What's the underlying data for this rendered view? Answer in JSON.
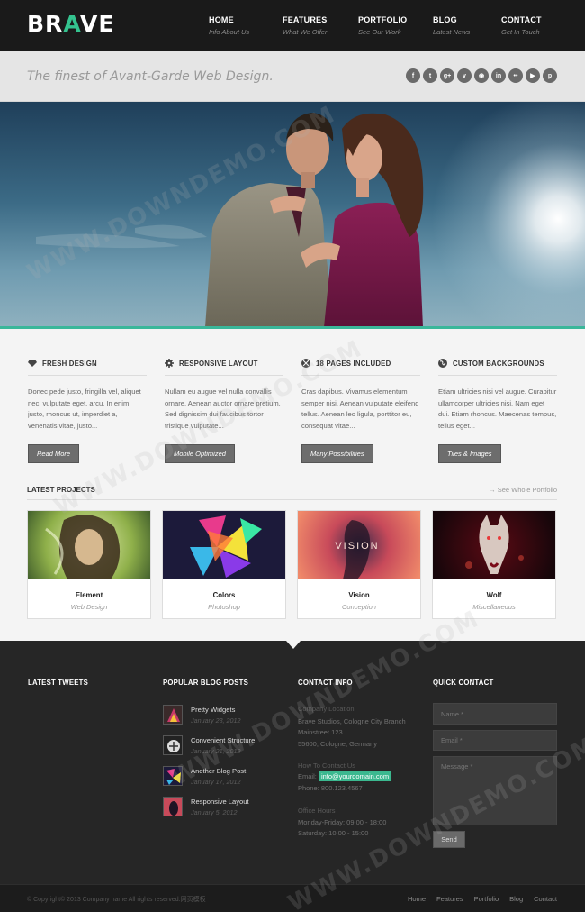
{
  "header": {
    "logo_part1": "BR",
    "logo_accent": "A",
    "logo_part2": "VE",
    "nav": [
      {
        "label": "HOME",
        "sub": "Info About Us"
      },
      {
        "label": "FEATURES",
        "sub": "What We Offer"
      },
      {
        "label": "PORTFOLIO",
        "sub": "See Our Work"
      },
      {
        "label": "BLOG",
        "sub": "Latest News"
      },
      {
        "label": "CONTACT",
        "sub": "Get In Touch"
      }
    ]
  },
  "tagline": "The finest of Avant-Garde Web Design.",
  "social_icons": [
    "facebook-icon",
    "twitter-icon",
    "google-plus-icon",
    "vimeo-icon",
    "rss-icon",
    "linkedin-icon",
    "flickr-icon",
    "youtube-icon",
    "pinterest-icon"
  ],
  "social_glyphs": [
    "f",
    "t",
    "g+",
    "v",
    "◉",
    "in",
    "••",
    "▶",
    "p"
  ],
  "features": [
    {
      "icon": "diamond-icon",
      "title": "FRESH DESIGN",
      "text": "Donec pede justo, fringilla vel, aliquet nec, vulputate eget, arcu. In enim justo, rhoncus ut, imperdiet a, venenatis vitae, justo...",
      "button": "Read More"
    },
    {
      "icon": "gear-icon",
      "title": "RESPONSIVE LAYOUT",
      "text": "Nullam eu augue vel nulla convallis ornare. Aenean auctor ornare pretium. Sed dignissim dui faucibus tortor tristique vulputate...",
      "button": "Mobile Optimized"
    },
    {
      "icon": "grid-circle-icon",
      "title": "18 PAGES INCLUDED",
      "text": "Cras dapibus. Vivamus elementum semper nisi. Aenean vulputate eleifend tellus. Aenean leo ligula, porttitor eu, consequat vitae...",
      "button": "Many Possibilities"
    },
    {
      "icon": "globe-icon",
      "title": "CUSTOM BACKGROUNDS",
      "text": "Etiam ultricies nisi vel augue. Curabitur ullamcorper ultricies nisi. Nam eget dui. Etiam rhoncus. Maecenas tempus, tellus eget...",
      "button": "Tiles & Images"
    }
  ],
  "projects": {
    "title": "LATEST PROJECTS",
    "link": "→ See Whole Portfolio",
    "items": [
      {
        "title": "Element",
        "category": "Web Design"
      },
      {
        "title": "Colors",
        "category": "Photoshop"
      },
      {
        "title": "Vision",
        "category": "Conception",
        "thumb_text": "VISION"
      },
      {
        "title": "Wolf",
        "category": "Miscellaneous"
      }
    ]
  },
  "footer": {
    "tweets_title": "LATEST TWEETS",
    "blog_title": "POPULAR BLOG POSTS",
    "posts": [
      {
        "title": "Pretty Widgets",
        "date": "January 23, 2012"
      },
      {
        "title": "Convenient Structure",
        "date": "January 21, 2012"
      },
      {
        "title": "Another Blog Post",
        "date": "January 17, 2012"
      },
      {
        "title": "Responsive Layout",
        "date": "January 5, 2012"
      }
    ],
    "contact_title": "CONTACT INFO",
    "location_label": "Company Location",
    "address": [
      "Brave Studios, Cologne City Branch",
      "Mainstreet 123",
      "55600, Cologne, Germany"
    ],
    "how_label": "How To Contact Us",
    "email_label": "Email:",
    "email": "info@yourdomain.com",
    "phone": "Phone: 800.123.4567",
    "hours_label": "Office Hours",
    "hours": [
      "Monday-Friday: 09:00 - 18:00",
      "Saturday: 10:00 - 15:00"
    ],
    "quick_title": "QUICK CONTACT",
    "name_placeholder": "Name *",
    "email_placeholder": "Email *",
    "message_placeholder": "Message *",
    "send": "Send"
  },
  "bottom": {
    "copyright": "© Copyright© 2013 Company name All rights reserved.网页模板",
    "links": [
      "Home",
      "Features",
      "Portfolio",
      "Blog",
      "Contact"
    ]
  },
  "watermark": "WWW.DOWNDEMO.COM"
}
